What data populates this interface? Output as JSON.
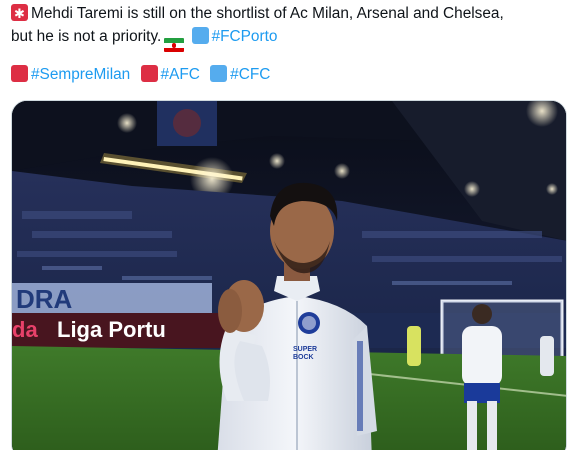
{
  "tweet": {
    "line1_text": "Mehdi Taremi is still on the shortlist of Ac Milan, Arsenal and Chelsea,",
    "line2_text": "but he is not a priority.",
    "hashtag_porto": "#FCPorto",
    "hashtags": [
      {
        "label": "#SempreMilan",
        "emoji": "red-square"
      },
      {
        "label": "#AFC",
        "emoji": "red-square"
      },
      {
        "label": "#CFC",
        "emoji": "blue-square"
      }
    ]
  },
  "photo": {
    "banner_text": "Liga Portu",
    "banner_prefix": "da",
    "jersey_text_line1": "SUPER",
    "jersey_text_line2": "BOCK",
    "stand_text": "DRA"
  },
  "colors": {
    "hashtag": "#1d9bf0",
    "text": "#0f1419",
    "red_square": "#dd2e44",
    "blue_square": "#55acee"
  }
}
